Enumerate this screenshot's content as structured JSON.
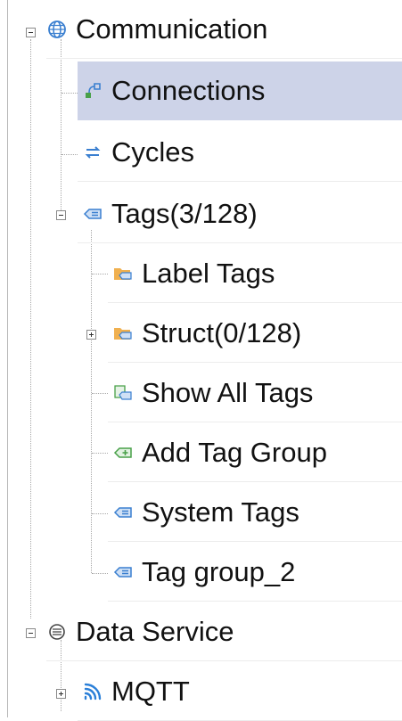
{
  "tree": {
    "communication": {
      "label": "Communication",
      "icon": "globe-icon",
      "expander": "collapse"
    },
    "connections": {
      "label": "Connections",
      "icon": "connection-icon",
      "selected": true
    },
    "cycles": {
      "label": "Cycles",
      "icon": "cycle-icon"
    },
    "tags": {
      "label": "Tags(3/128)",
      "icon": "tag-icon",
      "expander": "collapse"
    },
    "label_tags": {
      "label": "Label Tags",
      "icon": "folder-tag-icon"
    },
    "struct": {
      "label": "Struct(0/128)",
      "icon": "folder-tag-icon",
      "expander": "expand"
    },
    "show_all_tags": {
      "label": "Show All Tags",
      "icon": "show-tags-icon"
    },
    "add_tag_group": {
      "label": "Add Tag Group",
      "icon": "add-tag-icon"
    },
    "system_tags": {
      "label": "System Tags",
      "icon": "tag-icon"
    },
    "tag_group_2": {
      "label": "Tag group_2",
      "icon": "tag-icon"
    },
    "data_service": {
      "label": "Data Service",
      "icon": "data-service-icon",
      "expander": "collapse"
    },
    "mqtt": {
      "label": "MQTT",
      "icon": "mqtt-icon",
      "expander": "expand"
    }
  },
  "colors": {
    "selection": "#cdd3e8",
    "tag_blue": "#3a7fd0",
    "folder_orange": "#e8a04a",
    "add_green": "#4aa04a",
    "mqtt_blue": "#2a7fd8"
  }
}
